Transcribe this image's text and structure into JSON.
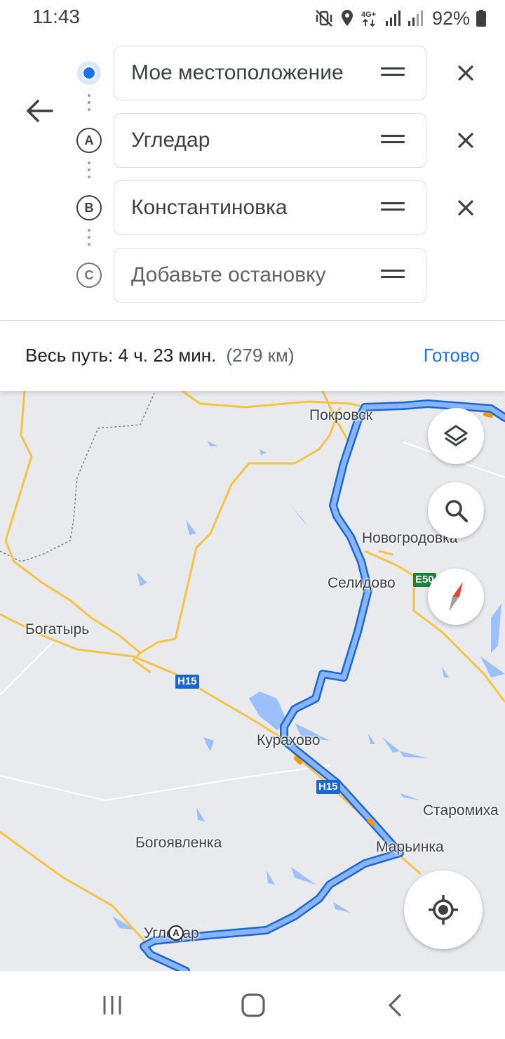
{
  "status_bar": {
    "time": "11:43",
    "battery": "92%",
    "network": "4G+",
    "icons": [
      "mute-vibrate-icon",
      "location-icon",
      "network-4g-icon",
      "signal-icon",
      "signal-icon",
      "battery-icon"
    ]
  },
  "directions": {
    "stops": [
      {
        "marker": "",
        "text": "Мое местоположение",
        "removable": true
      },
      {
        "marker": "A",
        "text": "Угледар",
        "removable": true
      },
      {
        "marker": "B",
        "text": "Константиновка",
        "removable": true
      },
      {
        "marker": "C",
        "placeholder": "Добавьте остановку",
        "removable": false
      }
    ]
  },
  "summary": {
    "text": "Весь путь: 4 ч. 23 мин.",
    "distance": "(279 км)",
    "done_label": "Готово"
  },
  "map": {
    "places": {
      "pokrovsk": "Покровск",
      "novogrodovka": "Новогродовка",
      "selidovo": "Селидово",
      "bogatyr": "Богатырь",
      "kurakhovo": "Курахово",
      "staromikha": "Старомиха",
      "marinka": "Марьинка",
      "bogoyavlenka": "Богоявленка",
      "ugledar": "Угледар"
    },
    "road_shields": {
      "h15_a": "H15",
      "h15_b": "H15",
      "e50": "E50"
    },
    "route_marker": "A",
    "colors": {
      "route": "#4285f4",
      "route_outline": "#1967d2",
      "road": "#f6c344",
      "water": "#9cc0f9",
      "land": "#e8eaed"
    }
  },
  "nav_bar": {
    "buttons": [
      "recent-apps",
      "home",
      "back"
    ]
  }
}
